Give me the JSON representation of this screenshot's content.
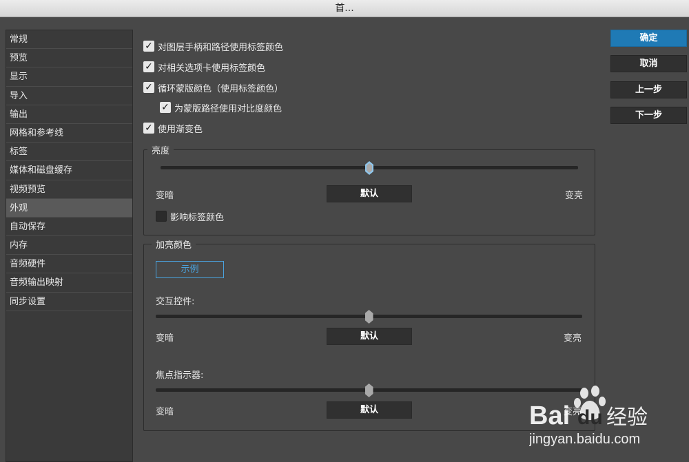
{
  "window": {
    "title": "首..."
  },
  "sidebar": {
    "items": [
      {
        "label": "常规"
      },
      {
        "label": "预览"
      },
      {
        "label": "显示"
      },
      {
        "label": "导入"
      },
      {
        "label": "输出"
      },
      {
        "label": "网格和参考线"
      },
      {
        "label": "标签"
      },
      {
        "label": "媒体和磁盘缓存"
      },
      {
        "label": "视频预览"
      },
      {
        "label": "外观",
        "selected": true
      },
      {
        "label": "自动保存"
      },
      {
        "label": "内存"
      },
      {
        "label": "音频硬件"
      },
      {
        "label": "音频输出映射"
      },
      {
        "label": "同步设置"
      }
    ]
  },
  "options": {
    "layer_handles": {
      "label": "对图层手柄和路径使用标签颜色",
      "checked": true
    },
    "related_tabs": {
      "label": "对相关选项卡使用标签颜色",
      "checked": true
    },
    "cycle_mask": {
      "label": "循环蒙版颜色（使用标签颜色）",
      "checked": true
    },
    "mask_contrast": {
      "label": "为蒙版路径使用对比度颜色",
      "checked": true
    },
    "gradients": {
      "label": "使用渐变色",
      "checked": true
    }
  },
  "brightness": {
    "title": "亮度",
    "dark_label": "变暗",
    "default_label": "默认",
    "light_label": "变亮",
    "affect_label": {
      "label": "影响标签颜色",
      "checked": false
    },
    "slider_value": 0.5
  },
  "highlight": {
    "title": "加亮颜色",
    "example_label": "示例",
    "interactive": {
      "label": "交互控件:",
      "dark_label": "变暗",
      "default_label": "默认",
      "light_label": "变亮",
      "slider_value": 0.5
    },
    "focus": {
      "label": "焦点指示器:",
      "dark_label": "变暗",
      "default_label": "默认",
      "light_label": "变亮",
      "slider_value": 0.5
    }
  },
  "buttons": {
    "ok": "确定",
    "cancel": "取消",
    "prev": "上一步",
    "next": "下一步"
  },
  "watermark": {
    "brand": "Bai",
    "brand2": "du",
    "cn": "经验",
    "url": "jingyan.baidu.com"
  },
  "colors": {
    "accent": "#1f7ab5",
    "example_border": "#4aa3df",
    "background": "#484848"
  }
}
